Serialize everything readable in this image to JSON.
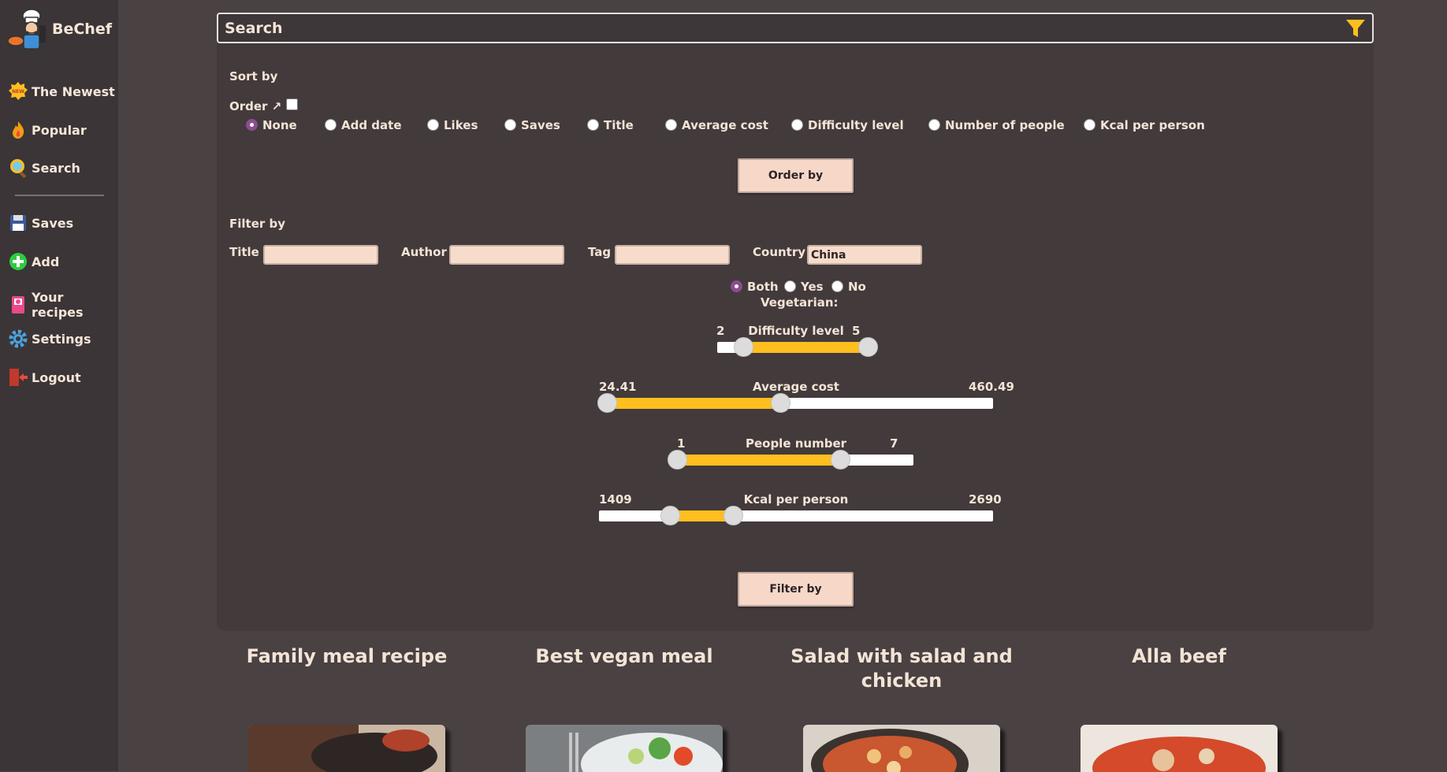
{
  "app": {
    "name": "BeChef"
  },
  "sidebar": {
    "items": [
      {
        "label": "The Newest",
        "icon": "new-badge-icon"
      },
      {
        "label": "Popular",
        "icon": "flame-icon"
      },
      {
        "label": "Search",
        "icon": "magnifier-icon"
      },
      {
        "label": "Saves",
        "icon": "floppy-disk-icon"
      },
      {
        "label": "Add",
        "icon": "plus-circle-icon"
      },
      {
        "label": "Your recipes",
        "icon": "recipe-book-icon"
      },
      {
        "label": "Settings",
        "icon": "gear-icon"
      },
      {
        "label": "Logout",
        "icon": "logout-door-icon"
      }
    ]
  },
  "search": {
    "placeholder": "Search",
    "filter_icon": "funnel-icon"
  },
  "sort": {
    "title": "Sort by",
    "order_label": "Order ↗",
    "options": [
      "None",
      "Add date",
      "Likes",
      "Saves",
      "Title",
      "Average cost",
      "Difficulty level",
      "Number of people",
      "Kcal per person"
    ],
    "selected": "None",
    "button": "Order by"
  },
  "filter": {
    "title": "Filter by",
    "fields": {
      "title": {
        "label": "Title",
        "value": ""
      },
      "author": {
        "label": "Author",
        "value": ""
      },
      "tag": {
        "label": "Tag",
        "value": ""
      },
      "country": {
        "label": "Country",
        "value": "China"
      }
    },
    "vegetarian": {
      "label": "Vegetarian:",
      "options": [
        "Both",
        "Yes",
        "No"
      ],
      "selected": "Both"
    },
    "difficulty": {
      "label": "Difficulty level",
      "min_label": "2",
      "max_label": "5",
      "low_fraction": 0.17,
      "high_fraction": 0.97
    },
    "average_cost": {
      "label": "Average cost",
      "min_label": "24.41",
      "max_label": "460.49",
      "low_fraction": 0.02,
      "high_fraction": 0.46
    },
    "people": {
      "label": "People number",
      "min_label": "1",
      "max_label": "7",
      "low_fraction": 0.03,
      "high_fraction": 0.7
    },
    "kcal": {
      "label": "Kcal per person",
      "min_label": "1409",
      "max_label": "2690",
      "low_fraction": 0.18,
      "high_fraction": 0.34
    },
    "button": "Filter by"
  },
  "cards": [
    {
      "title": "Family meal recipe"
    },
    {
      "title": "Best vegan meal"
    },
    {
      "title": "Salad with salad and chicken"
    },
    {
      "title": "Alla beef"
    }
  ],
  "colors": {
    "accent": "#ffbf1f",
    "button_bg": "#f7d8c8",
    "radio_selected": "#8b4d8f"
  }
}
